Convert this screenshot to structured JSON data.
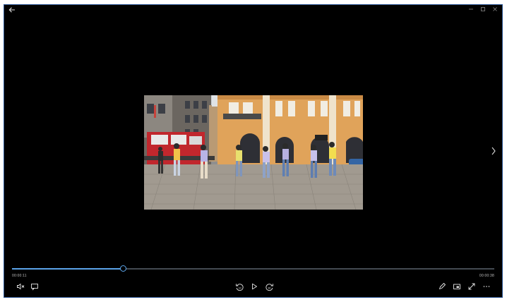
{
  "app": {
    "title_bar": {
      "back_icon": "arrow-left-icon",
      "controls": [
        "minimize-icon",
        "maximize-icon",
        "close-icon"
      ]
    }
  },
  "player": {
    "progress_fraction": 0.232,
    "current_time": "00:00:11",
    "total_time": "00:00:38"
  },
  "controls": {
    "left": [
      "volume-muted-icon",
      "captions-icon"
    ],
    "center": [
      "rewind-10-icon",
      "play-icon",
      "forward-30-icon"
    ],
    "right": [
      "edit-pen-icon",
      "mini-view-icon",
      "fullscreen-icon",
      "more-icon"
    ]
  },
  "colors": {
    "accent": "#5ba3e8",
    "window_border": "#2b5797",
    "background": "#000000"
  }
}
